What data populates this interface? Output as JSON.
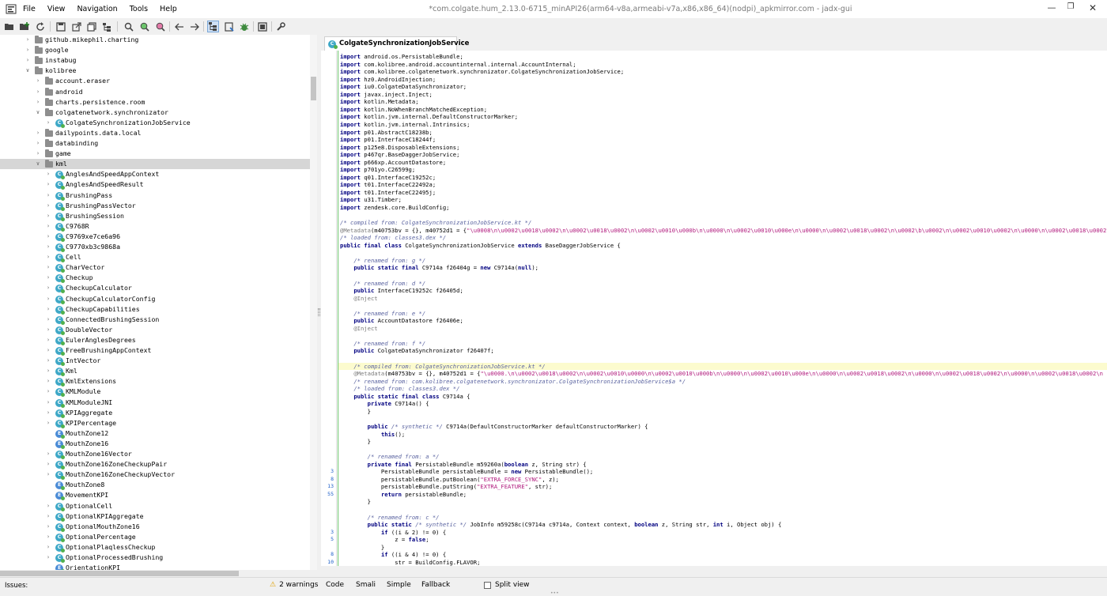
{
  "window": {
    "title": "*com.colgate.hum_2.13.0-6715_minAPI26(arm64-v8a,armeabi-v7a,x86,x86_64)(nodpi)_apkmirror.com - jadx-gui"
  },
  "menu": [
    "File",
    "View",
    "Navigation",
    "Tools",
    "Help"
  ],
  "toolbar": {
    "icons": [
      "open-file-icon",
      "add-file-icon",
      "reload-icon",
      "save-icon",
      "export-icon",
      "copy-icon",
      "tree-icon",
      "search-icon",
      "search-class-icon",
      "search-usage-icon",
      "back-icon",
      "forward-icon",
      "sync-tree-icon",
      "flatten-packages-icon",
      "debug-icon",
      "log-icon",
      "preferences-icon"
    ]
  },
  "tree": {
    "rows": [
      {
        "label": "github.mikephil.charting",
        "level": 1,
        "kind": "package",
        "expanded": false
      },
      {
        "label": "google",
        "level": 1,
        "kind": "package",
        "expanded": false
      },
      {
        "label": "instabug",
        "level": 1,
        "kind": "package",
        "expanded": false
      },
      {
        "label": "kolibree",
        "level": 1,
        "kind": "package",
        "expanded": true
      },
      {
        "label": "account.eraser",
        "level": 2,
        "kind": "package",
        "expanded": false
      },
      {
        "label": "android",
        "level": 2,
        "kind": "package",
        "expanded": false
      },
      {
        "label": "charts.persistence.room",
        "level": 2,
        "kind": "package",
        "expanded": false
      },
      {
        "label": "colgatenetwork.synchronizator",
        "level": 2,
        "kind": "package",
        "expanded": true
      },
      {
        "label": "ColgateSynchronizationJobService",
        "level": 3,
        "kind": "class",
        "expanded": false
      },
      {
        "label": "dailypoints.data.local",
        "level": 2,
        "kind": "package",
        "expanded": false
      },
      {
        "label": "databinding",
        "level": 2,
        "kind": "package",
        "expanded": false
      },
      {
        "label": "game",
        "level": 2,
        "kind": "package",
        "expanded": false
      },
      {
        "label": "kml",
        "level": 2,
        "kind": "package",
        "expanded": true,
        "selected": true
      },
      {
        "label": "AnglesAndSpeedAppContext",
        "level": 3,
        "kind": "class"
      },
      {
        "label": "AnglesAndSpeedResult",
        "level": 3,
        "kind": "class"
      },
      {
        "label": "BrushingPass",
        "level": 3,
        "kind": "class"
      },
      {
        "label": "BrushingPassVector",
        "level": 3,
        "kind": "class"
      },
      {
        "label": "BrushingSession",
        "level": 3,
        "kind": "class"
      },
      {
        "label": "C9768R",
        "level": 3,
        "kind": "class"
      },
      {
        "label": "C9769xe7ce6a96",
        "level": 3,
        "kind": "class"
      },
      {
        "label": "C9770xb3c9868a",
        "level": 3,
        "kind": "class"
      },
      {
        "label": "Cell",
        "level": 3,
        "kind": "class"
      },
      {
        "label": "CharVector",
        "level": 3,
        "kind": "class"
      },
      {
        "label": "Checkup",
        "level": 3,
        "kind": "class"
      },
      {
        "label": "CheckupCalculator",
        "level": 3,
        "kind": "class"
      },
      {
        "label": "CheckupCalculatorConfig",
        "level": 3,
        "kind": "class"
      },
      {
        "label": "CheckupCapabilities",
        "level": 3,
        "kind": "class"
      },
      {
        "label": "ConnectedBrushingSession",
        "level": 3,
        "kind": "class"
      },
      {
        "label": "DoubleVector",
        "level": 3,
        "kind": "class"
      },
      {
        "label": "EulerAnglesDegrees",
        "level": 3,
        "kind": "class"
      },
      {
        "label": "FreeBrushingAppContext",
        "level": 3,
        "kind": "class"
      },
      {
        "label": "IntVector",
        "level": 3,
        "kind": "class"
      },
      {
        "label": "Kml",
        "level": 3,
        "kind": "class"
      },
      {
        "label": "KmlExtensions",
        "level": 3,
        "kind": "class"
      },
      {
        "label": "KMLModule",
        "level": 3,
        "kind": "class"
      },
      {
        "label": "KMLModuleJNI",
        "level": 3,
        "kind": "class"
      },
      {
        "label": "KPIAggregate",
        "level": 3,
        "kind": "class"
      },
      {
        "label": "KPIPercentage",
        "level": 3,
        "kind": "class"
      },
      {
        "label": "MouthZone12",
        "level": 3,
        "kind": "enum"
      },
      {
        "label": "MouthZone16",
        "level": 3,
        "kind": "enum"
      },
      {
        "label": "MouthZone16Vector",
        "level": 3,
        "kind": "class"
      },
      {
        "label": "MouthZone16ZoneCheckupPair",
        "level": 3,
        "kind": "class"
      },
      {
        "label": "MouthZone16ZoneCheckupVector",
        "level": 3,
        "kind": "class"
      },
      {
        "label": "MouthZone8",
        "level": 3,
        "kind": "enum"
      },
      {
        "label": "MovementKPI",
        "level": 3,
        "kind": "enum"
      },
      {
        "label": "OptionalCell",
        "level": 3,
        "kind": "class"
      },
      {
        "label": "OptionalKPIAggregate",
        "level": 3,
        "kind": "class"
      },
      {
        "label": "OptionalMouthZone16",
        "level": 3,
        "kind": "class"
      },
      {
        "label": "OptionalPercentage",
        "level": 3,
        "kind": "class"
      },
      {
        "label": "OptionalPlaqlessCheckup",
        "level": 3,
        "kind": "class"
      },
      {
        "label": "OptionalProcessedBrushing",
        "level": 3,
        "kind": "class"
      },
      {
        "label": "OrientationKPI",
        "level": 3,
        "kind": "enum"
      }
    ]
  },
  "editor": {
    "tab_label": "ColgateSynchronizationJobService",
    "lines": [
      {
        "n": "",
        "html": "<span class='kw'>import</span> android.os.PersistableBundle;"
      },
      {
        "n": "",
        "html": "<span class='kw'>import</span> com.kolibree.android.accountinternal.internal.AccountInternal;"
      },
      {
        "n": "",
        "html": "<span class='kw'>import</span> com.kolibree.colgatenetwork.synchronizator.ColgateSynchronizationJobService;"
      },
      {
        "n": "",
        "html": "<span class='kw'>import</span> hz0.AndroidInjection;"
      },
      {
        "n": "",
        "html": "<span class='kw'>import</span> iu0.ColgateDataSynchronizator;"
      },
      {
        "n": "",
        "html": "<span class='kw'>import</span> javax.inject.Inject;"
      },
      {
        "n": "",
        "html": "<span class='kw'>import</span> kotlin.Metadata;"
      },
      {
        "n": "",
        "html": "<span class='kw'>import</span> kotlin.NoWhenBranchMatchedException;"
      },
      {
        "n": "",
        "html": "<span class='kw'>import</span> kotlin.jvm.internal.DefaultConstructorMarker;"
      },
      {
        "n": "",
        "html": "<span class='kw'>import</span> kotlin.jvm.internal.Intrinsics;"
      },
      {
        "n": "",
        "html": "<span class='kw'>import</span> p01.AbstractC18238b;"
      },
      {
        "n": "",
        "html": "<span class='kw'>import</span> p01.InterfaceC18244f;"
      },
      {
        "n": "",
        "html": "<span class='kw'>import</span> p125e8.DisposableExtensions;"
      },
      {
        "n": "",
        "html": "<span class='kw'>import</span> p467qr.BaseDaggerJobService;"
      },
      {
        "n": "",
        "html": "<span class='kw'>import</span> p666xp.AccountDatastore;"
      },
      {
        "n": "",
        "html": "<span class='kw'>import</span> p701yo.C26599g;"
      },
      {
        "n": "",
        "html": "<span class='kw'>import</span> q01.InterfaceC19252c;"
      },
      {
        "n": "",
        "html": "<span class='kw'>import</span> t01.InterfaceC22492a;"
      },
      {
        "n": "",
        "html": "<span class='kw'>import</span> t01.InterfaceC22495j;"
      },
      {
        "n": "",
        "html": "<span class='kw'>import</span> u31.Timber;"
      },
      {
        "n": "",
        "html": "<span class='kw'>import</span> zendesk.core.BuildConfig;"
      },
      {
        "n": "",
        "html": ""
      },
      {
        "n": "",
        "html": "<span class='cm'>/* compiled from: ColgateSynchronizationJobService.kt */</span>"
      },
      {
        "n": "",
        "html": "<span class='an'>@Metadata</span>(m40753bv = {}, m40752d1 = {<span class='st'>\"\\u0008\\n\\u0002\\u0018\\u0002\\n\\u0002\\u0018\\u0002\\n\\u0002\\u0010\\u000b\\n\\u0000\\n\\u0002\\u0010\\u000e\\n\\u0000\\n\\u0002\\u0018\\u0002\\n\\u0002\\b\\u0002\\n\\u0002\\u0010\\u0002\\n\\u0000\\n\\u0002\\u0018\\u0002\\n\\u0002\\u0018\\u0002\\n</span>"
      },
      {
        "n": "",
        "html": "<span class='cm'>/* loaded from: classes3.dex */</span>"
      },
      {
        "n": "",
        "html": "<span class='kw'>public final class</span> ColgateSynchronizationJobService <span class='kw'>extends</span> BaseDaggerJobService {"
      },
      {
        "n": "",
        "html": ""
      },
      {
        "n": "",
        "html": "    <span class='cm'>/* renamed from: g */</span>"
      },
      {
        "n": "",
        "html": "    <span class='kw'>public static final</span> C9714a f26404g = <span class='kw'>new</span> C9714a(<span class='kw'>null</span>);"
      },
      {
        "n": "",
        "html": ""
      },
      {
        "n": "",
        "html": "    <span class='cm'>/* renamed from: d */</span>"
      },
      {
        "n": "",
        "html": "    <span class='kw'>public</span> InterfaceC19252c f26405d;"
      },
      {
        "n": "",
        "html": "    <span class='an'>@Inject</span>"
      },
      {
        "n": "",
        "html": ""
      },
      {
        "n": "",
        "html": "    <span class='cm'>/* renamed from: e */</span>"
      },
      {
        "n": "",
        "html": "    <span class='kw'>public</span> AccountDatastore f26406e;"
      },
      {
        "n": "",
        "html": "    <span class='an'>@Inject</span>"
      },
      {
        "n": "",
        "html": ""
      },
      {
        "n": "",
        "html": "    <span class='cm'>/* renamed from: f */</span>"
      },
      {
        "n": "",
        "html": "    <span class='kw'>public</span> ColgateDataSynchronizator f26407f;"
      },
      {
        "n": "",
        "html": ""
      },
      {
        "n": "",
        "html": "    <span class='cm'>/* compiled from: ColgateSynchronizationJobService.kt */</span>",
        "hl": true
      },
      {
        "n": "",
        "html": "    <span class='an'>@Metadata</span>(m40753bv = {}, m40752d1 = {<span class='st'>\"\\u0000.\\n\\u0002\\u0018\\u0002\\n\\u0002\\u0010\\u0000\\n\\u0002\\u0010\\u000b\\n\\u0000\\n\\u0002\\u0010\\u000e\\n\\u0000\\n\\u0002\\u0018\\u0002\\n\\u0000\\n\\u0002\\u0018\\u0002\\n\\u0000\\n\\u0002\\u0018\\u0002\\n</span>"
      },
      {
        "n": "",
        "html": "    <span class='cm'>/* renamed from: com.kolibree.colgatenetwork.synchronizator.ColgateSynchronizationJobService$a */</span>"
      },
      {
        "n": "",
        "html": "    <span class='cm'>/* loaded from: classes3.dex */</span>"
      },
      {
        "n": "",
        "html": "    <span class='kw'>public static final class</span> C9714a {"
      },
      {
        "n": "",
        "html": "        <span class='kw'>private</span> C9714a() {"
      },
      {
        "n": "",
        "html": "        }"
      },
      {
        "n": "",
        "html": ""
      },
      {
        "n": "",
        "html": "        <span class='kw'>public</span> <span class='cm'>/* synthetic */</span> C9714a(DefaultConstructorMarker defaultConstructorMarker) {"
      },
      {
        "n": "",
        "html": "            <span class='kw'>this</span>();"
      },
      {
        "n": "",
        "html": "        }"
      },
      {
        "n": "",
        "html": ""
      },
      {
        "n": "",
        "html": "        <span class='cm'>/* renamed from: a */</span>"
      },
      {
        "n": "",
        "html": "        <span class='kw'>private final</span> PersistableBundle m59260a(<span class='kw'>boolean</span> z, String str) {"
      },
      {
        "n": "3",
        "html": "            PersistableBundle persistableBundle = <span class='kw'>new</span> PersistableBundle();"
      },
      {
        "n": "8",
        "html": "            persistableBundle.putBoolean(<span class='st'>\"EXTRA_FORCE_SYNC\"</span>, z);"
      },
      {
        "n": "13",
        "html": "            persistableBundle.putString(<span class='st'>\"EXTRA_FEATURE\"</span>, str);"
      },
      {
        "n": "55",
        "html": "            <span class='kw'>return</span> persistableBundle;"
      },
      {
        "n": "",
        "html": "        }"
      },
      {
        "n": "",
        "html": ""
      },
      {
        "n": "",
        "html": "        <span class='cm'>/* renamed from: c */</span>"
      },
      {
        "n": "",
        "html": "        <span class='kw'>public static</span> <span class='cm'>/* synthetic */</span> JobInfo m59258c(C9714a c9714a, Context context, <span class='kw'>boolean</span> z, String str, <span class='kw'>int</span> i, Object obj) {"
      },
      {
        "n": "3",
        "html": "            <span class='kw'>if</span> ((i &amp; 2) != 0) {"
      },
      {
        "n": "5",
        "html": "                z = <span class='kw'>false</span>;"
      },
      {
        "n": "",
        "html": "            }"
      },
      {
        "n": "8",
        "html": "            <span class='kw'>if</span> ((i &amp; 4) != 0) {"
      },
      {
        "n": "10",
        "html": "                str = BuildConfig.FLAVOR;"
      },
      {
        "n": "",
        "html": "            }"
      }
    ]
  },
  "status": {
    "issues_label": "Issues:",
    "warnings": "2 warnings",
    "tabs": [
      "Code",
      "Smali",
      "Simple",
      "Fallback"
    ],
    "split_view": "Split view"
  },
  "colors": {
    "accent": "#3ea8c7",
    "highlight": "#fcfbce",
    "keyword": "#000080",
    "string": "#b0187c",
    "comment": "#5a63a0"
  }
}
